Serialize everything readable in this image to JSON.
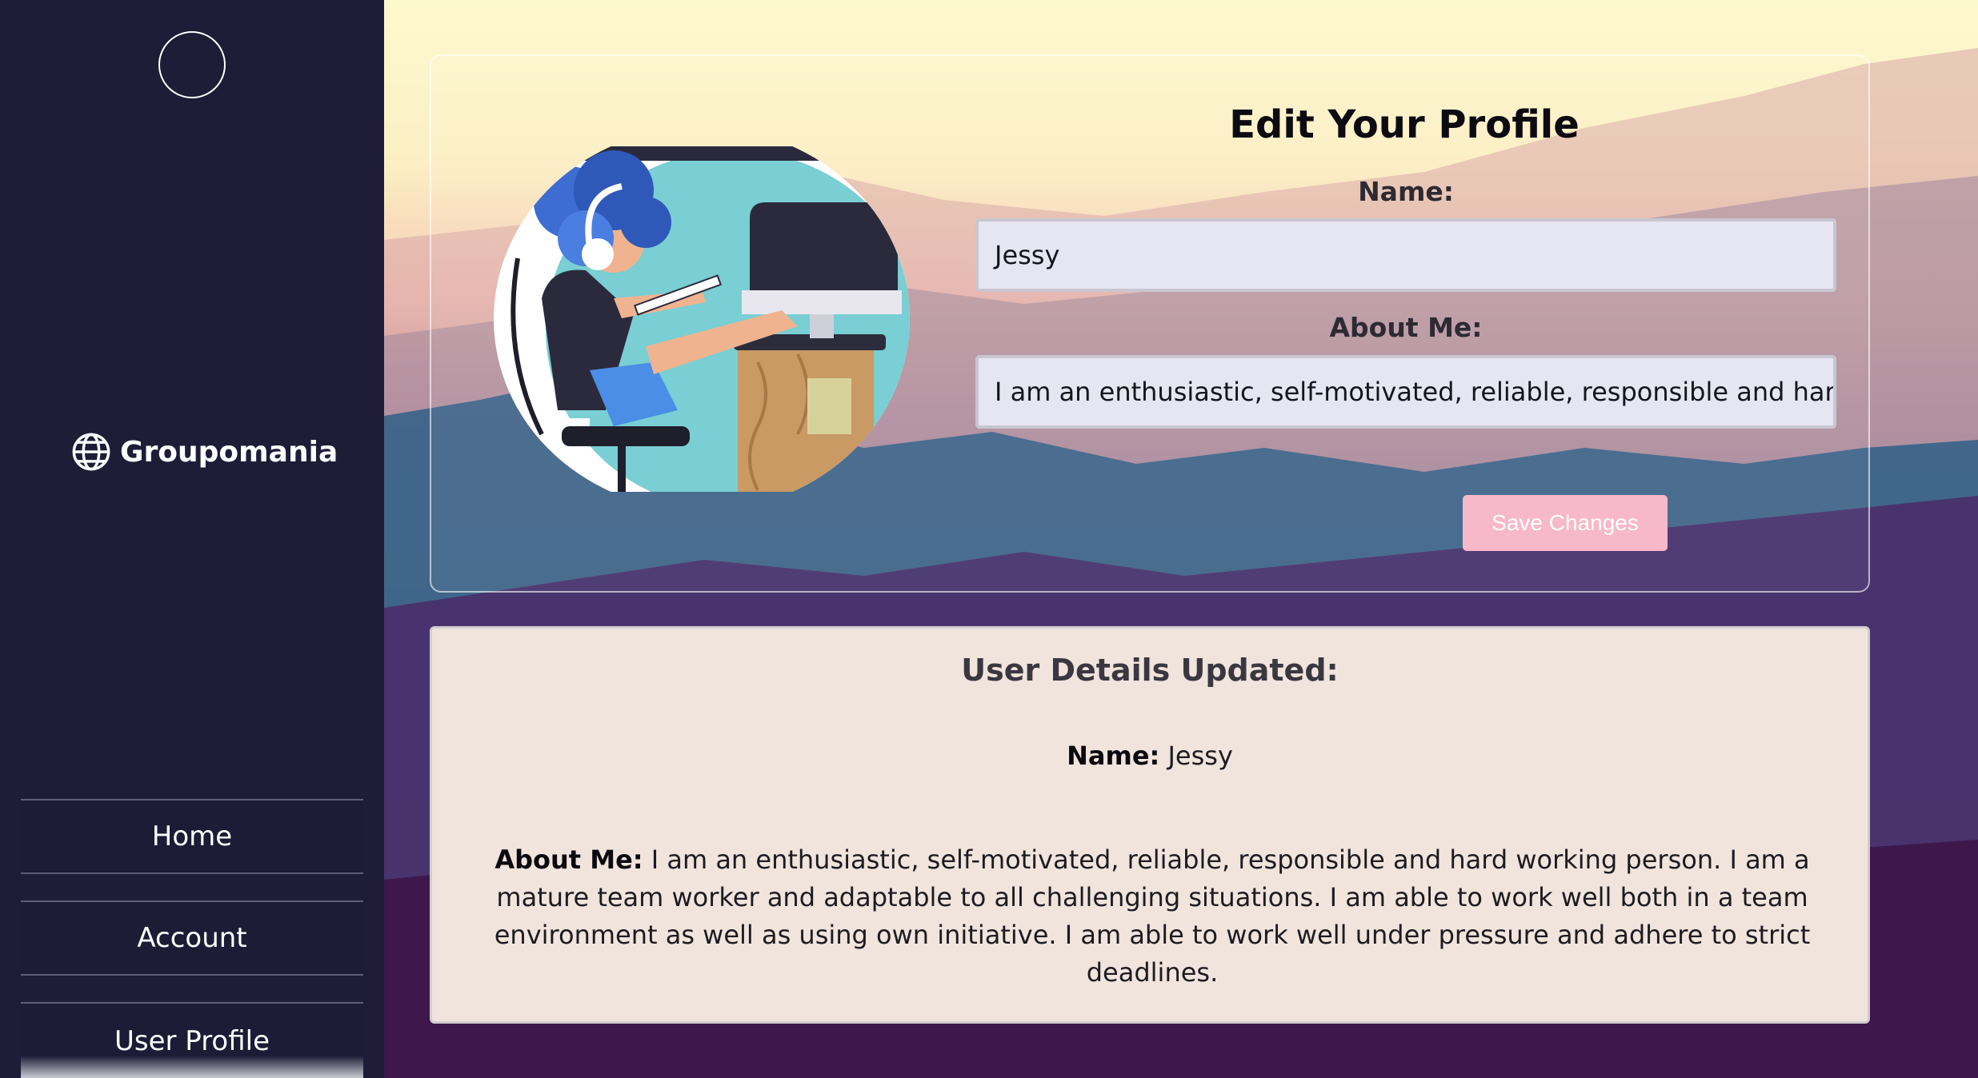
{
  "app": {
    "brand_name": "Groupomania"
  },
  "sidebar": {
    "items": [
      {
        "label": "Home"
      },
      {
        "label": "Account"
      },
      {
        "label": "User Profile"
      }
    ]
  },
  "edit_profile": {
    "title": "Edit Your Profile",
    "name_label": "Name:",
    "name_value": "Jessy",
    "about_label": "About Me:",
    "about_value": "I am an enthusiastic, self-motivated, reliable, responsible and hard working person. I am a mature team worker and adaptable to all challenging situations. I am able to work well both in a team environment as well as using own initiative. I am able to work well under pressure and adhere to strict deadlines.",
    "save_label": "Save Changes"
  },
  "details": {
    "title": "User Details Updated:",
    "name_label": "Name:",
    "name_value": "Jessy",
    "about_label": "About Me:",
    "about_value": "I am an enthusiastic, self-motivated, reliable, responsible and hard working person. I am a mature team worker and adaptable to all challenging situations. I am able to work well both in a team environment as well as using own initiative. I am able to work well under pressure and adhere to strict deadlines."
  },
  "colors": {
    "sidebar_bg": "#1e1c37",
    "save_button": "#f7b8c9",
    "details_bg": "#f1e4dd"
  },
  "icons": [
    "globe-icon"
  ]
}
